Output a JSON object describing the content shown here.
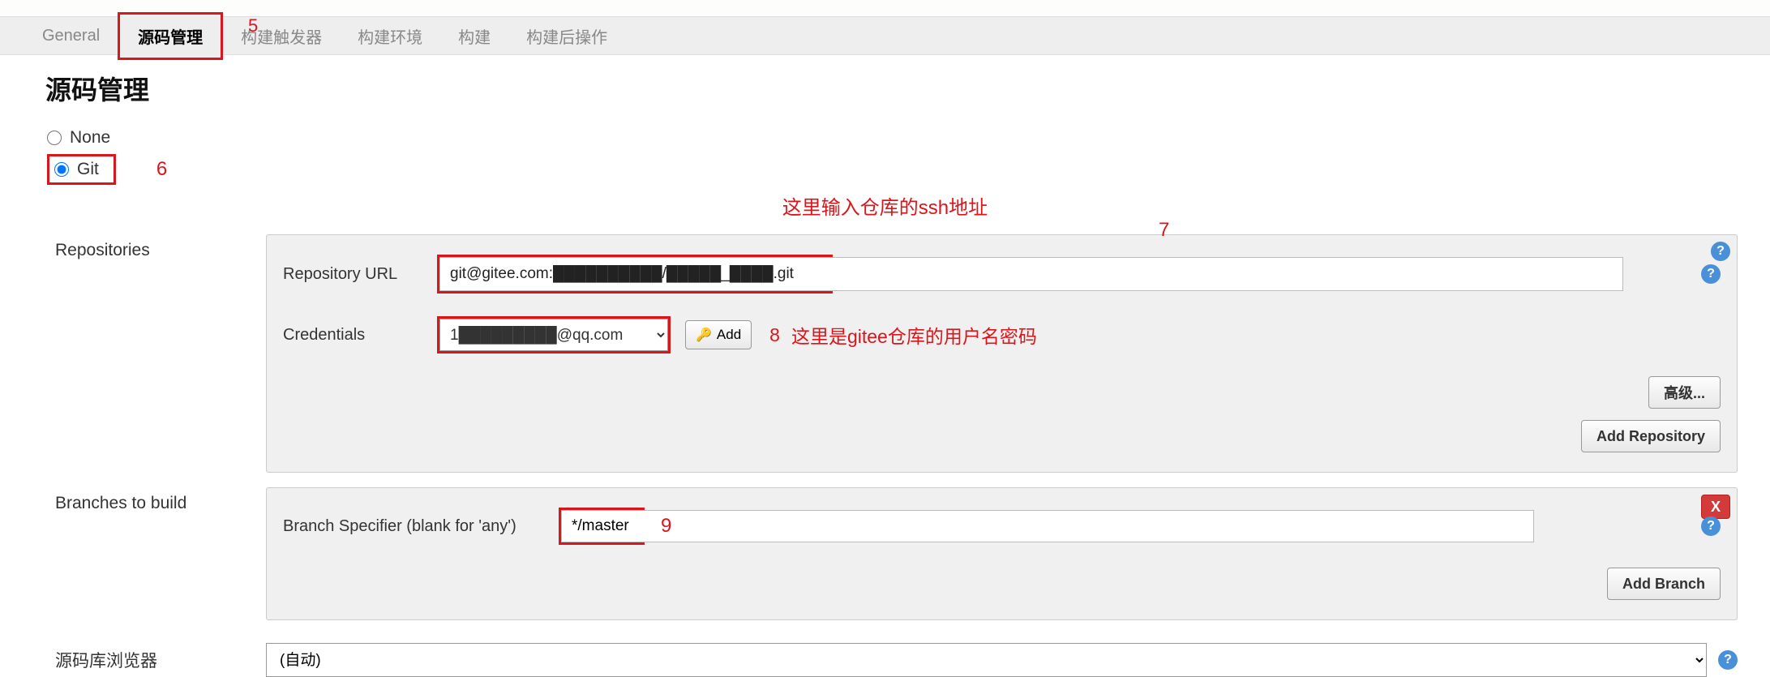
{
  "tabs": {
    "general": "General",
    "scm": "源码管理",
    "triggers": "构建触发器",
    "env": "构建环境",
    "build": "构建",
    "post": "构建后操作"
  },
  "section_title": "源码管理",
  "radio": {
    "none": "None",
    "git": "Git"
  },
  "annotations": {
    "a5": "5",
    "a6": "6",
    "a7": "7",
    "a8": "8",
    "a9": "9",
    "ssh_hint": "这里输入仓库的ssh地址",
    "cred_hint": "这里是gitee仓库的用户名密码"
  },
  "repositories": {
    "section_label": "Repositories",
    "url_label": "Repository URL",
    "url_value": "git@gitee.com:██████████/█████_████.git",
    "cred_label": "Credentials",
    "cred_value": "1█████████@qq.com",
    "add_btn": "Add",
    "advanced_btn": "高级...",
    "add_repo_btn": "Add Repository"
  },
  "branches": {
    "section_label": "Branches to build",
    "specifier_label": "Branch Specifier (blank for 'any')",
    "specifier_value": "*/master",
    "add_branch_btn": "Add Branch",
    "delete_x": "X"
  },
  "browser": {
    "label": "源码库浏览器",
    "value": "(自动)"
  },
  "help_char": "?"
}
